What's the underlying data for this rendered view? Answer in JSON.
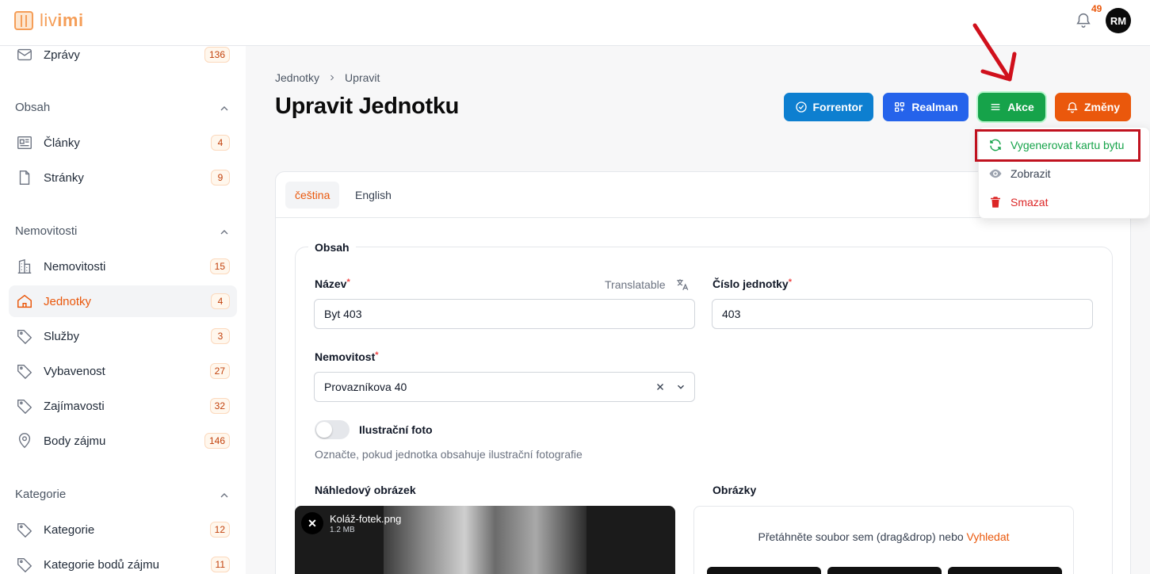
{
  "app": {
    "logo_text_light": "liv",
    "logo_text_bold": "imi",
    "notifications_count": "49",
    "user_initials": "RM"
  },
  "sidebar": {
    "top_item": {
      "label": "Zprávy",
      "badge": "136"
    },
    "groups": [
      {
        "title": "Obsah",
        "items": [
          {
            "label": "Články",
            "badge": "4",
            "icon": "article-icon"
          },
          {
            "label": "Stránky",
            "badge": "9",
            "icon": "page-icon"
          }
        ]
      },
      {
        "title": "Nemovitosti",
        "items": [
          {
            "label": "Nemovitosti",
            "badge": "15",
            "icon": "building-icon"
          },
          {
            "label": "Jednotky",
            "badge": "4",
            "icon": "home-icon",
            "active": true
          },
          {
            "label": "Služby",
            "badge": "3",
            "icon": "tag-icon"
          },
          {
            "label": "Vybavenost",
            "badge": "27",
            "icon": "tag-icon"
          },
          {
            "label": "Zajímavosti",
            "badge": "32",
            "icon": "tag-icon"
          },
          {
            "label": "Body zájmu",
            "badge": "146",
            "icon": "map-pin-icon"
          }
        ]
      },
      {
        "title": "Kategorie",
        "items": [
          {
            "label": "Kategorie",
            "badge": "12",
            "icon": "tag-icon"
          },
          {
            "label": "Kategorie bodů zájmu",
            "badge": "11",
            "icon": "tag-icon"
          }
        ]
      }
    ]
  },
  "header": {
    "breadcrumb": [
      "Jednotky",
      "Upravit"
    ],
    "title": "Upravit Jednotku",
    "buttons": {
      "forrentor": "Forrentor",
      "realman": "Realman",
      "akce": "Akce",
      "zmeny": "Změny"
    },
    "colors": {
      "forrentor": "#0d7fd0",
      "realman": "#2563eb",
      "akce": "#16a34a",
      "zmeny": "#ea580c"
    }
  },
  "actions_menu": {
    "items": [
      {
        "label": "Vygenerovat kartu bytu",
        "color": "#16a34a"
      },
      {
        "label": "Zobrazit",
        "color": "#374151"
      },
      {
        "label": "Smazat",
        "color": "#dc2626"
      }
    ]
  },
  "tabs": [
    "čeština",
    "English"
  ],
  "form": {
    "section_title": "Obsah",
    "name": {
      "label": "Název",
      "required": "*",
      "hint": "Translatable",
      "value": "Byt 403"
    },
    "unit_number": {
      "label": "Číslo jednotky",
      "required": "*",
      "value": "403"
    },
    "property": {
      "label": "Nemovitost",
      "required": "*",
      "value": "Provazníkova 40"
    },
    "illustration": {
      "label": "Ilustrační foto",
      "helper": "Označte, pokud jednotka obsahuje ilustrační fotografie"
    },
    "preview_image": {
      "label": "Náhledový obrázek",
      "file_name": "Koláž-fotek.png",
      "file_size": "1.2 MB"
    },
    "images": {
      "label": "Obrázky",
      "drop_text": "Přetáhněte soubor sem (drag&drop) nebo ",
      "drop_link": "Vyhledat"
    }
  }
}
